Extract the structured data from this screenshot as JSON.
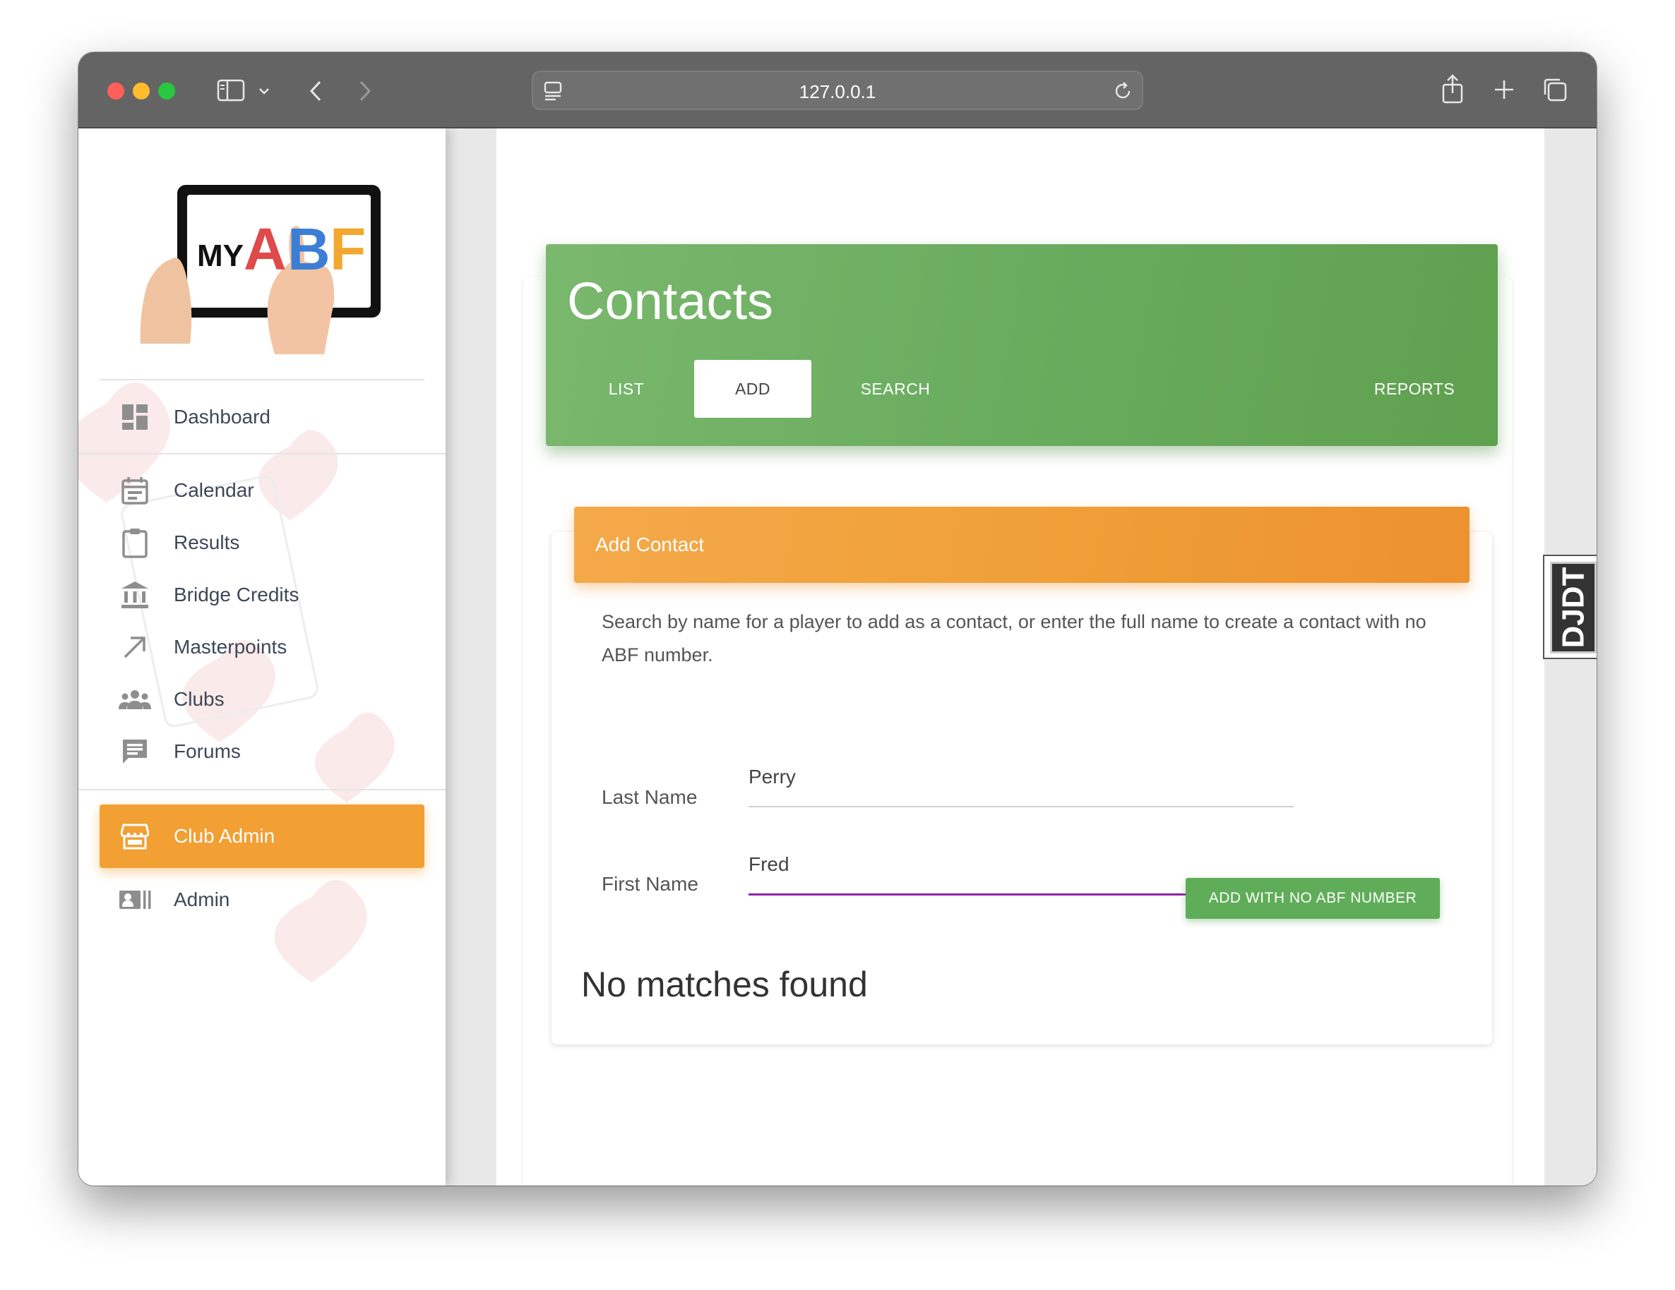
{
  "browser": {
    "url": "127.0.0.1"
  },
  "logo": {
    "text_my": "MY",
    "text_abf": "ABF"
  },
  "sidebar": {
    "items": [
      {
        "label": "Dashboard",
        "icon": "dashboard-icon"
      },
      {
        "label": "Calendar",
        "icon": "calendar-icon"
      },
      {
        "label": "Results",
        "icon": "clipboard-icon"
      },
      {
        "label": "Bridge Credits",
        "icon": "bank-icon"
      },
      {
        "label": "Masterpoints",
        "icon": "trending-arrow-icon"
      },
      {
        "label": "Clubs",
        "icon": "group-icon"
      },
      {
        "label": "Forums",
        "icon": "chat-icon"
      },
      {
        "label": "Club Admin",
        "icon": "storefront-icon"
      },
      {
        "label": "Admin",
        "icon": "id-card-icon"
      }
    ],
    "active": "Club Admin",
    "accent": "#f29f34"
  },
  "contacts": {
    "title": "Contacts",
    "tabs": [
      "LIST",
      "ADD",
      "SEARCH",
      "REPORTS"
    ],
    "active_tab": "ADD",
    "accent": "#6aac5f"
  },
  "form": {
    "header": "Add Contact",
    "description": "Search by name for a player to add as a contact, or enter the full name to create a contact with no ABF number.",
    "last_name_label": "Last Name",
    "last_name_value": "Perry",
    "first_name_label": "First Name",
    "first_name_value": "Fred",
    "button_label": "ADD WITH NO ABF NUMBER",
    "accent": "#f0a038",
    "focus_color": "#8e24aa"
  },
  "results": {
    "message": "No matches found"
  },
  "debug_toolbar": {
    "label": "DJDT"
  }
}
